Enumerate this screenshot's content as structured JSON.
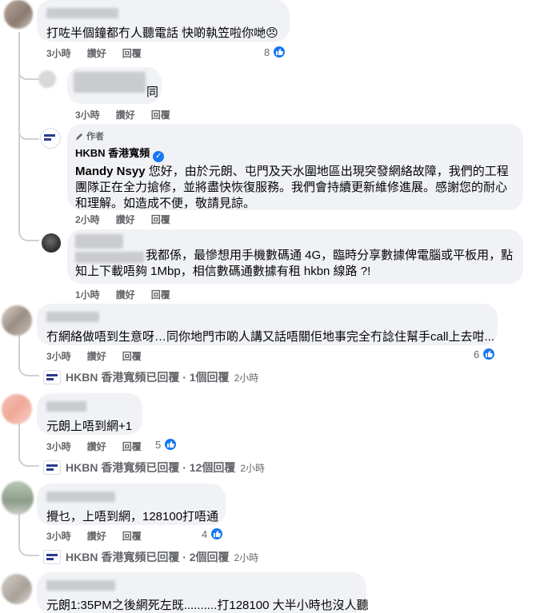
{
  "actions": {
    "like": "讚好",
    "reply": "回覆"
  },
  "comments": [
    {
      "text": "打咗半個鐘都冇人聽電話 快啲執笠啦你哋😠",
      "time": "3小時",
      "likes": "8"
    },
    {
      "text": "同",
      "time": "3小時"
    },
    {
      "author_badge": "作者",
      "author": "HKBN 香港寬頻",
      "mention": "Mandy Nsyy",
      "text": " 您好，由於元朗、屯門及天水圍地區出現突發網絡故障，我們的工程團隊正在全力搶修，並將盡快恢復服務。我們會持續更新維修進展。感謝您的耐心和理解。如造成不便，敬請見諒。",
      "time": "2小時"
    },
    {
      "text_line1": "我都係，最慘想用手機數碼通 4G，臨時分享數據俾電腦或平板用，點",
      "text_line2": "知上下載唔夠 1Mbp，相信數碼通數據有租 hkbn 線路 ?!",
      "time": "1小時"
    },
    {
      "text": "冇網絡做唔到生意呀…同你地門市啲人講又話唔關佢地事完全冇諗住幫手call上去咁...",
      "time": "3小時",
      "likes": "6",
      "reply_summary": "HKBN 香港寬頻已回覆 · 1個回覆",
      "reply_time": "2小時"
    },
    {
      "text": "元朗上唔到網+1",
      "time": "3小時",
      "likes": "5",
      "reply_summary": "HKBN 香港寬頻已回覆 · 12個回覆",
      "reply_time": "2小時"
    },
    {
      "text": "攪乜，上唔到網，128100打唔通",
      "time": "3小時",
      "likes": "4",
      "reply_summary": "HKBN 香港寬頻已回覆 · 2個回覆",
      "reply_time": "2小時"
    },
    {
      "text": "元朗1:35PM之後網死左既..........打128100 大半小時也沒人聽"
    }
  ]
}
